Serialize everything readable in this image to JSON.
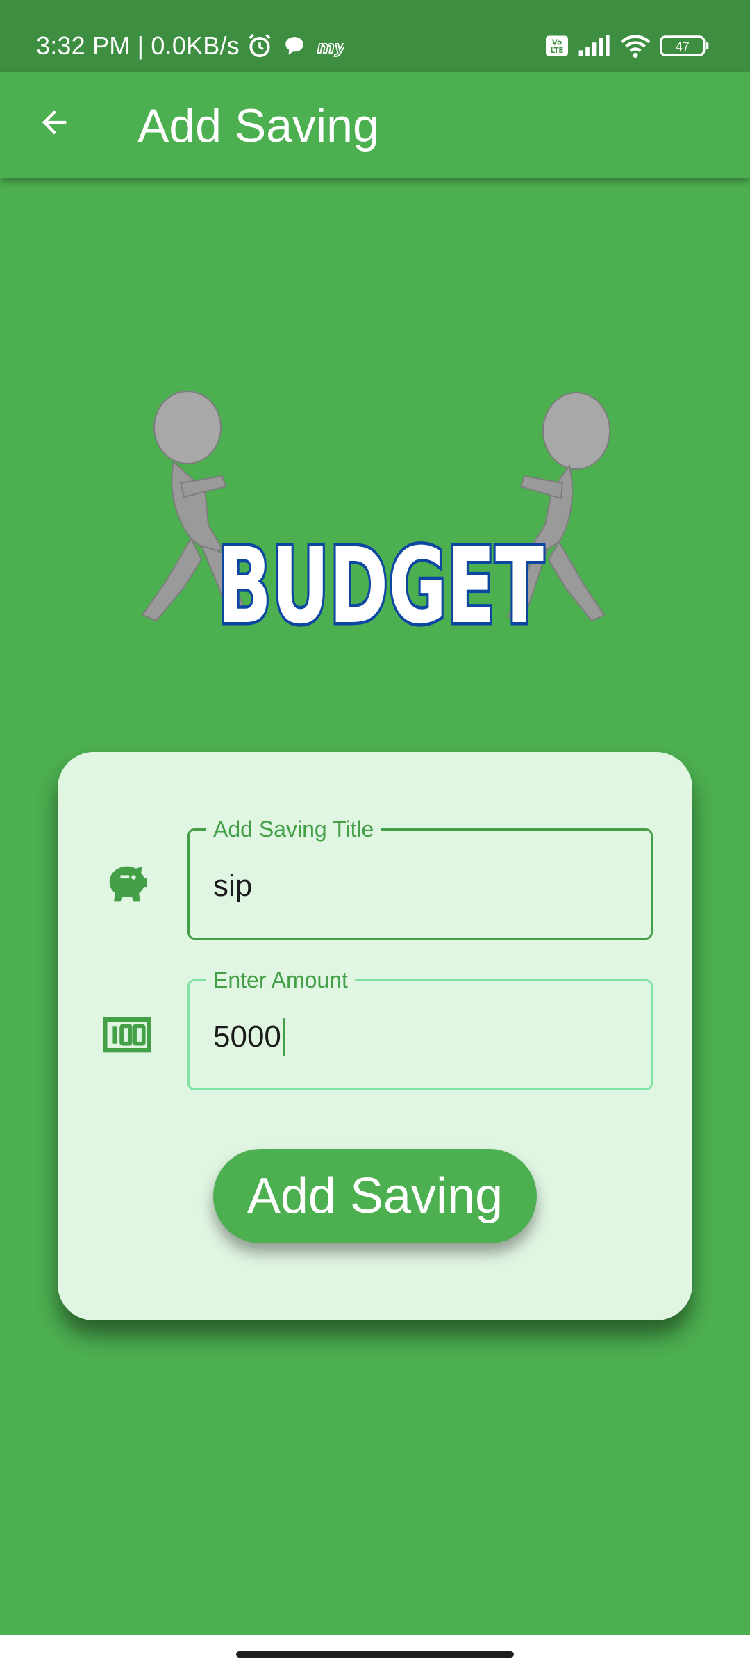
{
  "status_bar": {
    "time_speed": "3:32 PM | 0.0KB/s",
    "battery": "47",
    "icons": [
      "alarm-icon",
      "chat-bubble-icon",
      "my-app-icon",
      "volte-icon",
      "signal-icon",
      "wifi-icon",
      "battery-icon"
    ]
  },
  "app_bar": {
    "title": "Add Saving",
    "back_icon": "arrow-left-icon"
  },
  "hero": {
    "word": "BUDGET"
  },
  "form": {
    "title_field": {
      "label": "Add Saving Title",
      "value": "sip",
      "icon": "piggy-bank-icon"
    },
    "amount_field": {
      "label": "Enter Amount",
      "value": "5000",
      "icon": "money-100-icon"
    },
    "submit_label": "Add Saving"
  },
  "colors": {
    "primary": "#4CAF50",
    "status_bar": "#3E8E41",
    "card": "#E1F5E3",
    "accent": "#43A047",
    "field_border_alt": "#7EE3A3"
  }
}
